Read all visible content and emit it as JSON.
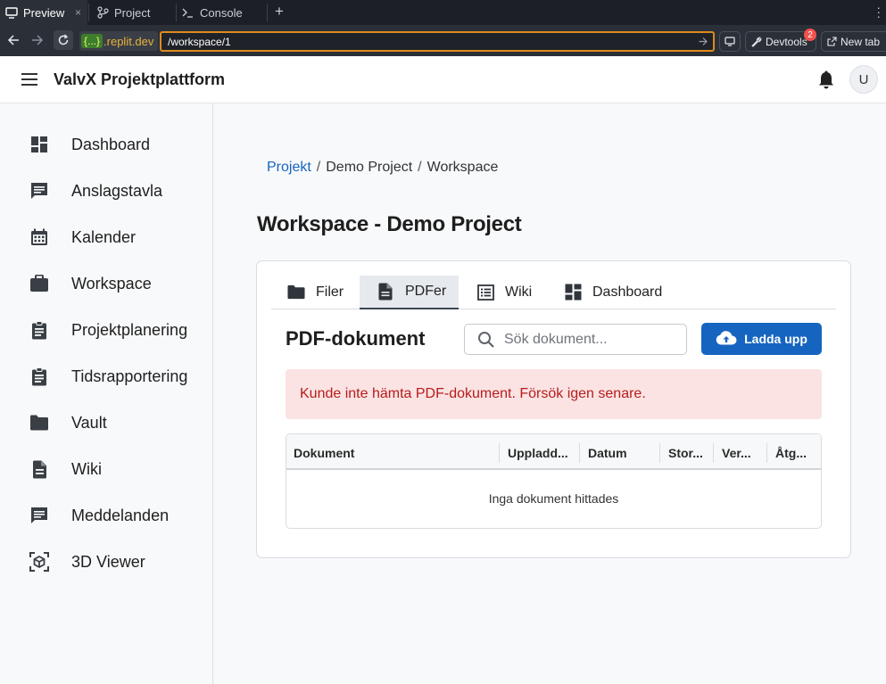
{
  "browser": {
    "tabs": [
      {
        "label": "Preview",
        "icon": "monitor-icon",
        "active": true,
        "close": "×"
      },
      {
        "label": "Project",
        "icon": "git-branch-icon"
      },
      {
        "label": "Console",
        "icon": "terminal-icon"
      }
    ],
    "new_tab_symbol": "+",
    "domain_badge": "{...}",
    "domain": ".replit.dev",
    "url_path": "/workspace/1",
    "devtools_label": "Devtools",
    "devtools_badge": "2",
    "new_tab_label": "New tab"
  },
  "app": {
    "title": "ValvX Projektplattform",
    "avatar_initial": "U"
  },
  "sidebar": {
    "items": [
      {
        "label": "Dashboard",
        "icon": "dashboard-icon"
      },
      {
        "label": "Anslagstavla",
        "icon": "message-board-icon"
      },
      {
        "label": "Kalender",
        "icon": "calendar-icon"
      },
      {
        "label": "Workspace",
        "icon": "briefcase-icon"
      },
      {
        "label": "Projektplanering",
        "icon": "clipboard-icon"
      },
      {
        "label": "Tidsrapportering",
        "icon": "clipboard-icon"
      },
      {
        "label": "Vault",
        "icon": "folder-icon"
      },
      {
        "label": "Wiki",
        "icon": "document-icon"
      },
      {
        "label": "Meddelanden",
        "icon": "chat-icon"
      },
      {
        "label": "3D Viewer",
        "icon": "cube-icon"
      }
    ]
  },
  "breadcrumb": {
    "items": [
      "Projekt",
      "Demo Project",
      "Workspace"
    ],
    "separator": "/"
  },
  "page": {
    "title": "Workspace - Demo Project"
  },
  "tabs": [
    {
      "label": "Filer",
      "icon": "folder-icon"
    },
    {
      "label": "PDFer",
      "icon": "pdf-document-icon",
      "active": true
    },
    {
      "label": "Wiki",
      "icon": "list-icon"
    },
    {
      "label": "Dashboard",
      "icon": "dashboard-icon"
    }
  ],
  "pdf_section": {
    "title": "PDF-dokument",
    "search_placeholder": "Sök dokument...",
    "upload_label": "Ladda upp",
    "error_message": "Kunde inte hämta PDF-dokument. Försök igen senare.",
    "table": {
      "columns": [
        "Dokument",
        "Uppladd...",
        "Datum",
        "Stor...",
        "Ver...",
        "Åtg..."
      ],
      "empty_text": "Inga dokument hittades"
    }
  },
  "colors": {
    "primary": "#1565c0",
    "error_bg": "#fbe3e3",
    "error_text": "#b71c1c",
    "url_outline": "#e08a1e"
  }
}
